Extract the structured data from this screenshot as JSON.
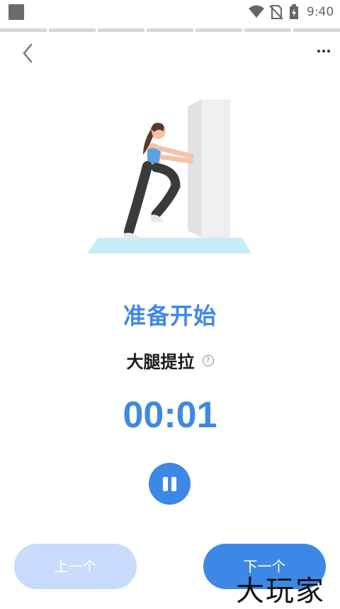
{
  "status_bar": {
    "time": "9:40",
    "icons": [
      "app-square-icon",
      "wifi-icon",
      "no-sim-icon",
      "battery-charging-icon"
    ]
  },
  "progress": {
    "segments_total": 7,
    "segments_done": 0
  },
  "header": {
    "back_icon": "chevron-left-icon",
    "more_icon": "more-dots-icon"
  },
  "illustration": {
    "subject": "woman doing wall leg-raise exercise"
  },
  "state_label": "准备开始",
  "exercise": {
    "name": "大腿提拉",
    "help_icon": "?"
  },
  "timer": "00:01",
  "controls": {
    "pause_icon": "pause-icon"
  },
  "navigation": {
    "prev_label": "上一个",
    "next_label": "下一个"
  },
  "watermark": "大玩家",
  "colors": {
    "accent": "#3e88e5",
    "prev_button": "#c9dbfb"
  }
}
